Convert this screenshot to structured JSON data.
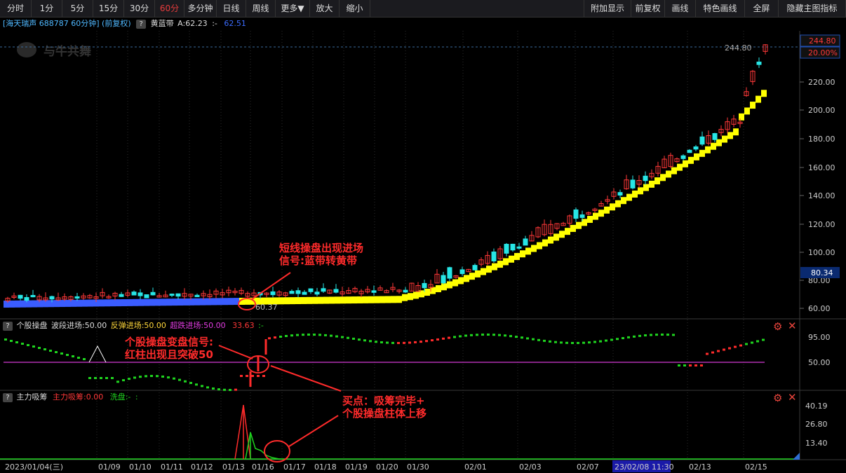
{
  "toolbar": {
    "periods": [
      "分时",
      "1分",
      "5分",
      "15分",
      "30分",
      "60分",
      "多分钟",
      "日线",
      "周线",
      "更多▼",
      "放大",
      "缩小"
    ],
    "active_period": "60分",
    "right": [
      "附加显示",
      "前复权",
      "画线",
      "特色画线",
      "全屏",
      "隐藏主图指标"
    ]
  },
  "header": {
    "stock_label": "[海天瑞声 688787 60分钟] (前复权)",
    "help": "?",
    "indicator_name": "黄蓝带",
    "indicator_value_a": "A:62.23",
    "indicator_sep": ":-",
    "indicator_value_b": "62.51",
    "watermark": "与牛共舞"
  },
  "main": {
    "y_ticks": [
      "220.00",
      "200.00",
      "180.00",
      "160.00",
      "140.00",
      "120.00",
      "100.00",
      "80.00",
      "60.00"
    ],
    "price_tag": "244.80",
    "price_pct": "20.00%",
    "price_line_label": "244.80",
    "current_tag": "80.34",
    "low_label": "60.37",
    "colors": {
      "up": "#ff3838",
      "down": "#27e6e6",
      "band": "#ffff00"
    }
  },
  "panel2": {
    "help": "?",
    "name": "个股操盘",
    "wave": "波段进场:50.00",
    "rebound": "反弹进场:50.00",
    "oversold": "超跌进场:50.00",
    "value": "33.63",
    "value_sep": ":-",
    "y_ticks": [
      "95.00",
      "50.00"
    ]
  },
  "panel3": {
    "help": "?",
    "name": "主力吸筹",
    "main_val": "主力吸筹:0.00",
    "wash": "洗盘:-",
    "wash_sep": ":",
    "y_ticks": [
      "40.19",
      "26.80",
      "13.40"
    ]
  },
  "xaxis": {
    "labels": [
      "2023/01/04(三)",
      "01/09",
      "01/10",
      "01/11",
      "01/12",
      "01/13",
      "01/16",
      "01/17",
      "01/18",
      "01/19",
      "01/20",
      "01/30",
      "02/01",
      "02/03",
      "02/07",
      "23/02/08 11:30",
      "02/13",
      "02/15"
    ]
  },
  "annotations": {
    "a1_line1": "短线操盘出现进场",
    "a1_line2": "信号:蓝带转黄带",
    "a2_line1": "个股操盘变盘信号:",
    "a2_line2": "红柱出现且突破50",
    "a3_line1": "买点：吸筹完毕+",
    "a3_line2": "个股操盘柱体上移"
  }
}
